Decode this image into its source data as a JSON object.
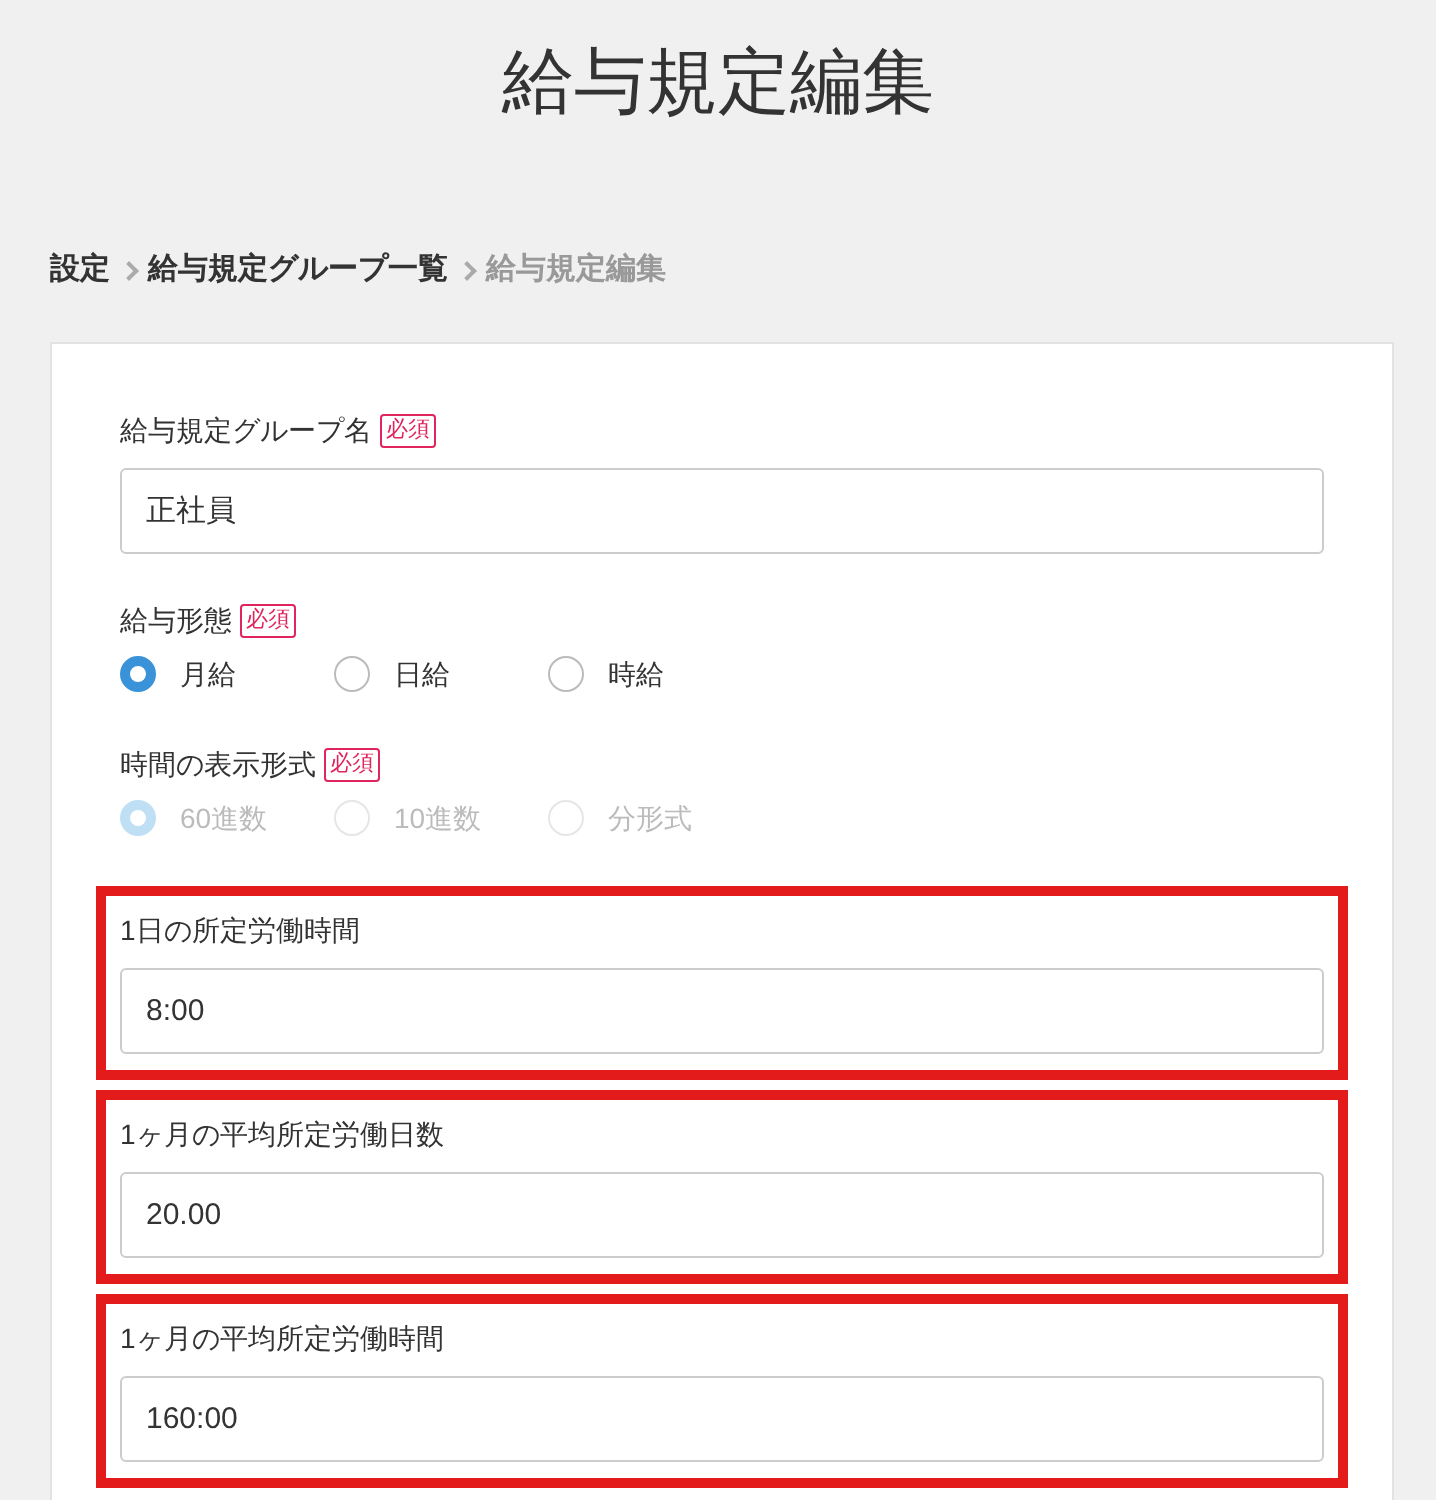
{
  "page_title": "給与規定編集",
  "breadcrumb": [
    {
      "label": "設定",
      "current": false
    },
    {
      "label": "給与規定グループ一覧",
      "current": false
    },
    {
      "label": "給与規定編集",
      "current": true
    }
  ],
  "fields": [
    {
      "kind": "text",
      "label": "給与規定グループ名",
      "required": "必須",
      "highlighted": false,
      "value": "正社員"
    },
    {
      "kind": "radio",
      "label": "給与形態",
      "required": "必須",
      "highlighted": false,
      "disabled": false,
      "options": [
        {
          "label": "月給",
          "selected": true
        },
        {
          "label": "日給",
          "selected": false
        },
        {
          "label": "時給",
          "selected": false
        }
      ]
    },
    {
      "kind": "radio",
      "label": "時間の表示形式",
      "required": "必須",
      "highlighted": false,
      "disabled": true,
      "options": [
        {
          "label": "60進数",
          "selected": true
        },
        {
          "label": "10進数",
          "selected": false
        },
        {
          "label": "分形式",
          "selected": false
        }
      ]
    },
    {
      "kind": "text",
      "label": "1日の所定労働時間",
      "highlighted": true,
      "value": "8:00"
    },
    {
      "kind": "text",
      "label": "1ヶ月の平均所定労働日数",
      "highlighted": true,
      "value": "20.00"
    },
    {
      "kind": "text",
      "label": "1ヶ月の平均所定労働時間",
      "highlighted": true,
      "value": "160:00"
    }
  ]
}
